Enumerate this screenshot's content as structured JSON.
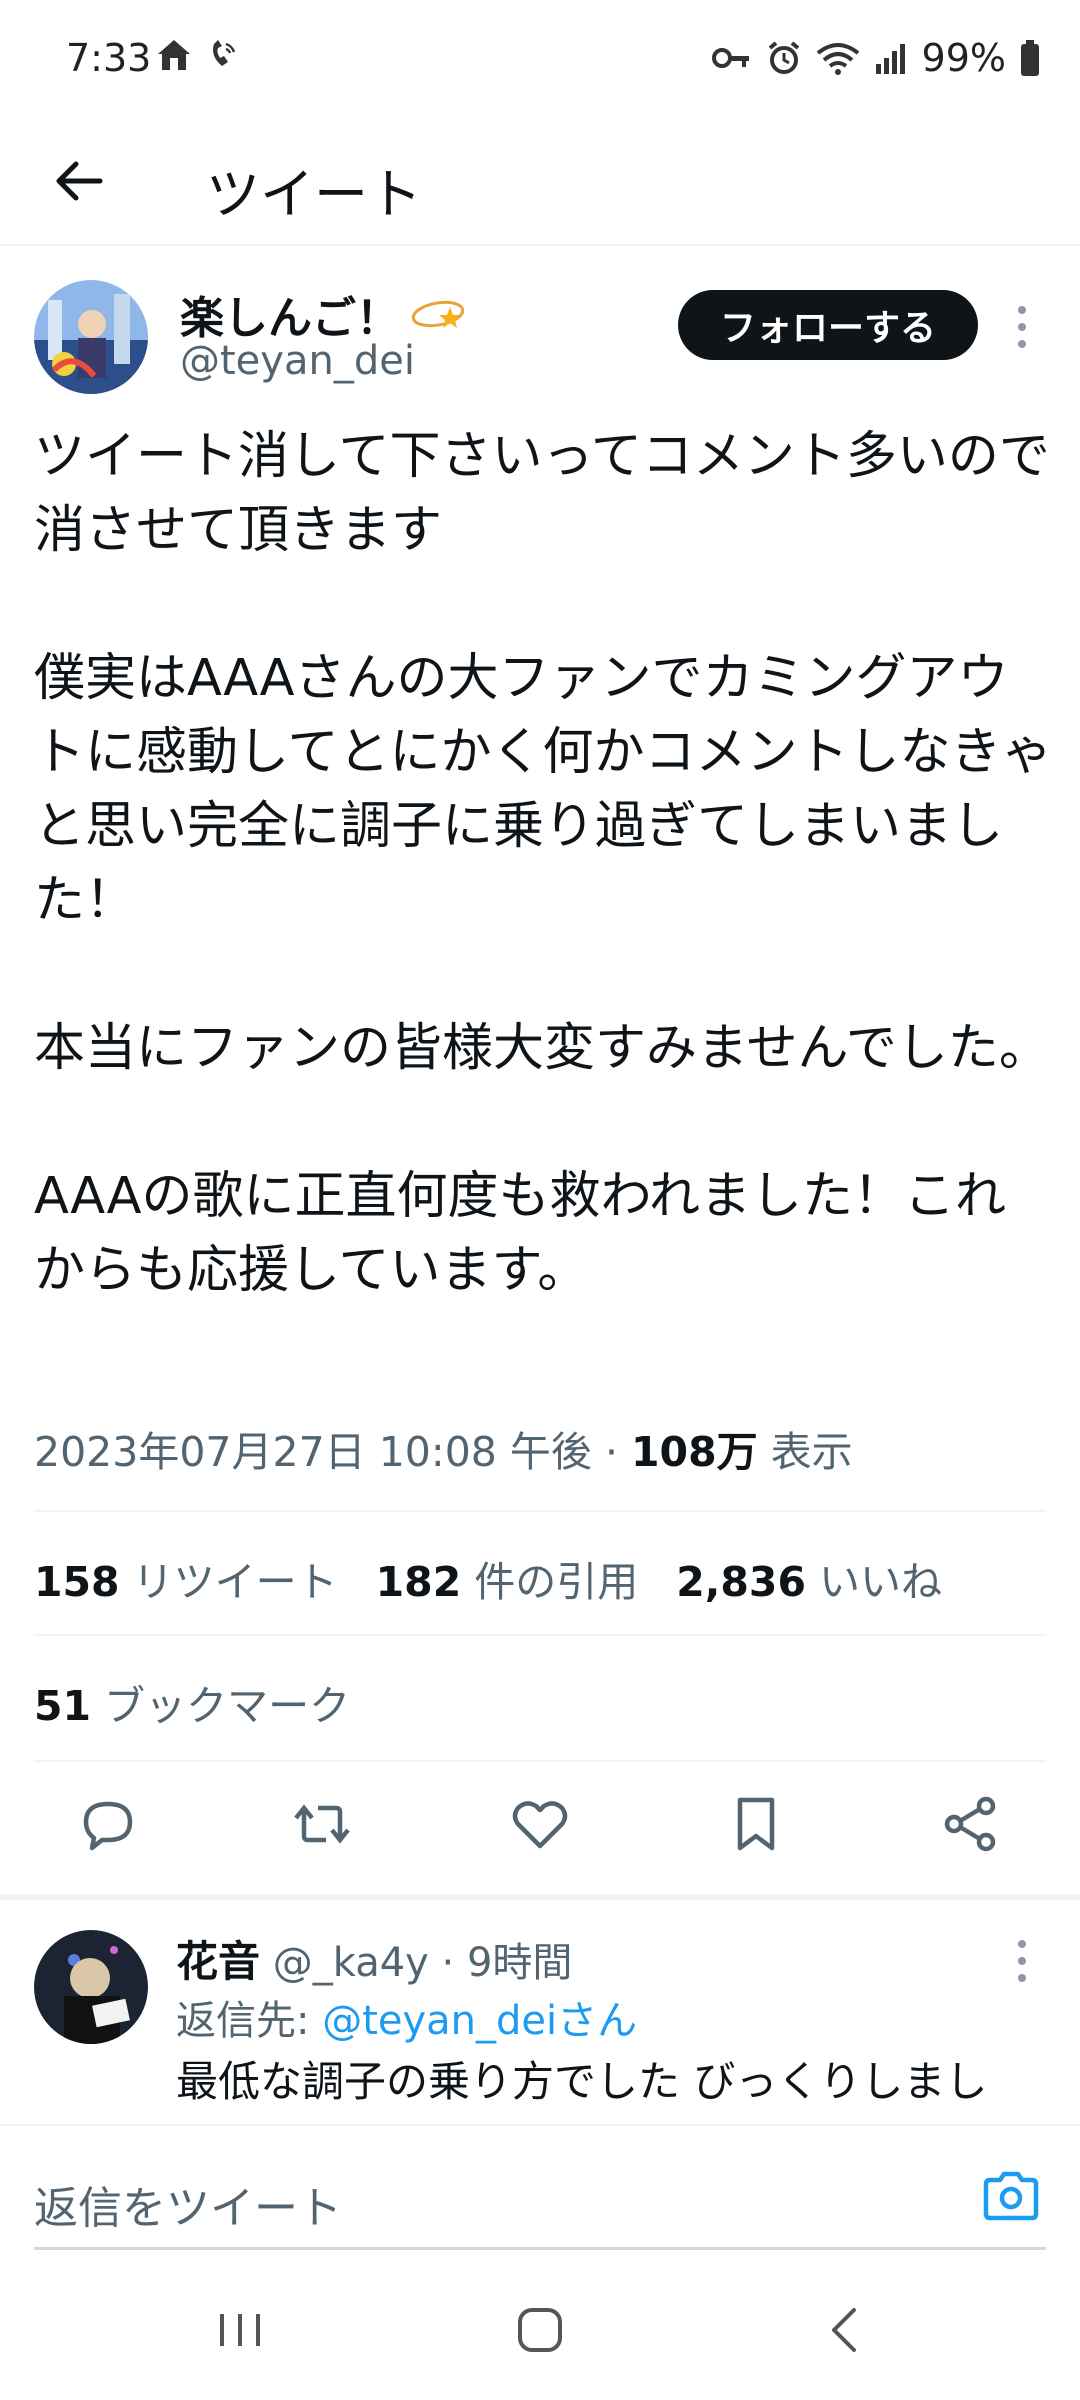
{
  "status_bar": {
    "time": "7:33",
    "battery": "99%"
  },
  "app_bar": {
    "title": "ツイート"
  },
  "author": {
    "name": "楽しんご！",
    "handle": "@teyan_dei",
    "follow_label": "フォローする"
  },
  "tweet": {
    "paragraphs": [
      "ツイート消して下さいってコメント多いので消させて頂きます",
      "僕実はAAAさんの大ファンでカミングアウトに感動してとにかく何かコメントしなきゃと思い完全に調子に乗り過ぎてしまいました！",
      "本当にファンの皆様大変すみませんでした。",
      "AAAの歌に正直何度も救われました！これからも応援しています。"
    ],
    "timestamp": "2023年07月27日 10:08 午後",
    "views_count": "108万",
    "views_label": "表示"
  },
  "stats": {
    "retweets_count": "158",
    "retweets_label": "リツイート",
    "quotes_count": "182",
    "quotes_label": "件の引用",
    "likes_count": "2,836",
    "likes_label": "いいね",
    "bookmarks_count": "51",
    "bookmarks_label": "ブックマーク"
  },
  "reply": {
    "name": "花音",
    "handle": "@_ka4y",
    "time": "9時間",
    "reply_to_prefix": "返信先: ",
    "reply_to_user": "@teyan_deiさん",
    "text": "最低な調子の乗り方でした びっくりしまし"
  },
  "composer": {
    "placeholder": "返信をツイート"
  },
  "colors": {
    "accent": "#1d9bf0",
    "text": "#0f1419",
    "secondary": "#536471",
    "divider": "#eff3f4"
  },
  "icons": [
    "home-icon",
    "wifi-calling-icon",
    "key-icon",
    "alarm-icon",
    "wifi-icon",
    "signal-icon",
    "battery-icon",
    "back-arrow-icon",
    "verified-badge-icon",
    "more-icon",
    "reply-icon",
    "retweet-icon",
    "like-icon",
    "bookmark-icon",
    "share-icon",
    "camera-icon",
    "recents-icon",
    "home-nav-icon",
    "back-nav-icon"
  ]
}
